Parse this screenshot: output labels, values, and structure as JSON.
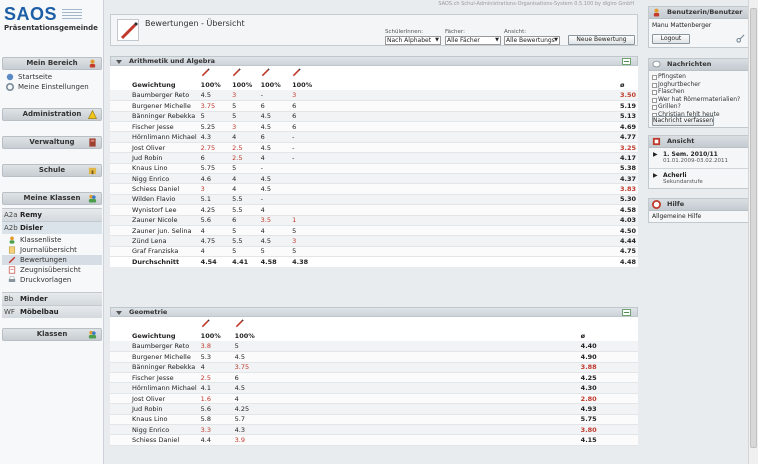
{
  "app_title": "SAOS.ch Schul-Administrations-Organisations-System 0.5.100 by digiro GmbH",
  "logo": {
    "name": "SAOS",
    "subtitle": "Präsentationsgemeinde"
  },
  "left": {
    "mein_bereich": "Mein Bereich",
    "mein_items": [
      "Startseite",
      "Meine Einstellungen"
    ],
    "administration": "Administration",
    "verwaltung": "Verwaltung",
    "schule": "Schule",
    "meine_klassen": "Meine Klassen",
    "klass1": {
      "code": "A2a",
      "name": "Remy"
    },
    "klass2": {
      "code": "A2b",
      "name": "Disler"
    },
    "klass2_items": [
      "Klassenliste",
      "Journalübersicht",
      "Bewertungen",
      "Zeugnisübersicht",
      "Druckvorlagen"
    ],
    "klass3": {
      "code": "Bb",
      "name": "Minder"
    },
    "klass4": {
      "code": "WF",
      "name": "Möbelbau"
    },
    "klassen": "Klassen"
  },
  "header": {
    "title": "Bewertungen - Übersicht",
    "f1_label": "SchülerInnen:",
    "f1_value": "Nach Alphabet",
    "f2_label": "Fächer:",
    "f2_value": "Alle Fächer",
    "f3_label": "Ansicht:",
    "f3_value": "Alle Bewertungs",
    "new_button": "Neue Bewertung"
  },
  "gewichtung_label": "Gewichtung",
  "avg_symbol": "ø",
  "durchschnitt_label": "Durchschnitt",
  "s1": {
    "title": "Arithmetik und Algebra",
    "weights": [
      "100%",
      "100%",
      "100%",
      "100%"
    ],
    "rows": [
      {
        "name": "Baumberger Reto",
        "a": "4.5",
        "b": "3",
        "c": "-",
        "d": "3",
        "avg": "3.50"
      },
      {
        "name": "Burgener Michelle",
        "a": "3.75",
        "b": "5",
        "c": "6",
        "d": "6",
        "avg": "5.19"
      },
      {
        "name": "Bänninger Rebekka",
        "a": "5",
        "b": "5",
        "c": "4.5",
        "d": "6",
        "avg": "5.13"
      },
      {
        "name": "Fischer Jesse",
        "a": "5.25",
        "b": "3",
        "c": "4.5",
        "d": "6",
        "avg": "4.69"
      },
      {
        "name": "Hörnlimann Michael",
        "a": "4.3",
        "b": "4",
        "c": "6",
        "d": "-",
        "avg": "4.77"
      },
      {
        "name": "Jost Oliver",
        "a": "2.75",
        "b": "2.5",
        "c": "4.5",
        "d": "-",
        "avg": "3.25"
      },
      {
        "name": "Jud Robin",
        "a": "6",
        "b": "2.5",
        "c": "4",
        "d": "-",
        "avg": "4.17"
      },
      {
        "name": "Knaus Lino",
        "a": "5.75",
        "b": "5",
        "c": "-",
        "d": "",
        "avg": "5.38"
      },
      {
        "name": "Nigg Enrico",
        "a": "4.6",
        "b": "4",
        "c": "4.5",
        "d": "",
        "avg": "4.37"
      },
      {
        "name": "Schiess Daniel",
        "a": "3",
        "b": "4",
        "c": "4.5",
        "d": "",
        "avg": "3.83"
      },
      {
        "name": "Wilden Flavio",
        "a": "5.1",
        "b": "5.5",
        "c": "-",
        "d": "",
        "avg": "5.30"
      },
      {
        "name": "Wynistorf Lee",
        "a": "4.25",
        "b": "5.5",
        "c": "4",
        "d": "",
        "avg": "4.58"
      },
      {
        "name": "Zauner Nicole",
        "a": "5.6",
        "b": "6",
        "c": "3.5",
        "d": "1",
        "avg": "4.03"
      },
      {
        "name": "Zauner jun. Selina",
        "a": "4",
        "b": "5",
        "c": "4",
        "d": "5",
        "avg": "4.50"
      },
      {
        "name": "Zünd Lena",
        "a": "4.75",
        "b": "5.5",
        "c": "4.5",
        "d": "3",
        "avg": "4.44"
      },
      {
        "name": "Graf Franziska",
        "a": "4",
        "b": "5",
        "c": "5",
        "d": "5",
        "avg": "4.75"
      }
    ],
    "avg": {
      "a": "4.54",
      "b": "4.41",
      "c": "4.58",
      "d": "4.38",
      "avg": "4.48"
    }
  },
  "s2": {
    "title": "Geometrie",
    "weights": [
      "100%",
      "100%"
    ],
    "rows": [
      {
        "name": "Baumberger Reto",
        "a": "3.8",
        "b": "5",
        "avg": "4.40"
      },
      {
        "name": "Burgener Michelle",
        "a": "5.3",
        "b": "4.5",
        "avg": "4.90"
      },
      {
        "name": "Bänninger Rebekka",
        "a": "4",
        "b": "3.75",
        "avg": "3.88"
      },
      {
        "name": "Fischer Jesse",
        "a": "2.5",
        "b": "6",
        "avg": "4.25"
      },
      {
        "name": "Hörnlimann Michael",
        "a": "4.1",
        "b": "4.5",
        "avg": "4.30"
      },
      {
        "name": "Jost Oliver",
        "a": "1.6",
        "b": "4",
        "avg": "2.80"
      },
      {
        "name": "Jud Robin",
        "a": "5.6",
        "b": "4.25",
        "avg": "4.93"
      },
      {
        "name": "Knaus Lino",
        "a": "5.8",
        "b": "5.7",
        "avg": "5.75"
      },
      {
        "name": "Nigg Enrico",
        "a": "3.3",
        "b": "4.3",
        "avg": "3.80"
      },
      {
        "name": "Schiess Daniel",
        "a": "4.4",
        "b": "3.9",
        "avg": "4.15"
      }
    ]
  },
  "right": {
    "benutzer_title": "Benutzerin/Benutzer",
    "user": "Manu Mattenberger",
    "logout": "Logout",
    "nachrichten_title": "Nachrichten",
    "nachrichten": [
      "Pfingsten",
      "Joghurtbecher",
      "Flaschen",
      "Wer hat Römermaterialien?",
      "Grillen?",
      "Christian fehlt heute"
    ],
    "nachricht_btn": "Nachricht verfassen",
    "ansicht_title": "Ansicht",
    "ansicht1": "1. Sem. 2010/11",
    "ansicht1_sub": "01.01.2009-03.02.2011",
    "ansicht2": "Acherli",
    "ansicht2_sub": "Sekundarstufe",
    "hilfe_title": "Hilfe",
    "hilfe_item": "Allgemeine Hilfe"
  }
}
